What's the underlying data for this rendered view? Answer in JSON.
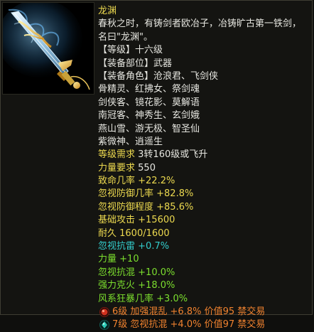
{
  "item": {
    "name": "龙渊",
    "description": [
      "春秋之时，有铸剑者欧冶子，冶铸旷古第一铁剑，",
      "名曰\"龙渊\"。"
    ],
    "level_line": "【等级】十六级",
    "slot_line": "【装备部位】武器",
    "roles_header": "【装备角色】沧浪君、飞剑侠",
    "roles_more": [
      "骨精灵、红拂女、祭剑魂",
      "剑侠客、镜花影、莫解语",
      "南冠客、神秀生、玄剑娥",
      "燕山雪、游无极、智圣仙",
      "紫微神、逍遥生"
    ]
  },
  "stats": {
    "level_req_label": "等级需求",
    "level_req_value": "3转160级或飞升",
    "str_req_label": "力量要求",
    "str_req_value": "550",
    "crit": "致命几率 +22.2%",
    "ignore_def_chance": "忽视防御几率 +82.8%",
    "ignore_def_degree": "忽视防御程度 +85.6%",
    "base_attack": "基础攻击 +15600",
    "durability": "耐久 1600/1600"
  },
  "bonus": {
    "ignore_thunder_label": "忽视抗雷",
    "ignore_thunder_value": "+0.7%",
    "strength_label": "力量",
    "strength_value": "+10",
    "ignore_chaos_label": "忽视抗混",
    "ignore_chaos_value": "+10.0%",
    "fire_label": "强力克火",
    "fire_value": "+18.0%",
    "wind_label": "风系狂暴几率",
    "wind_value": "+3.0%"
  },
  "gems": [
    {
      "icon": "red-gem-icon",
      "text": "6级 加强混乱 +6.8% 价值95 禁交易",
      "color": "#f0822f"
    },
    {
      "icon": "cyan-gem-icon",
      "text": "7级 忽视抗混 +4.0% 价值97 禁交易",
      "color": "#f0822f"
    }
  ],
  "colors": {
    "name": "#ecd94f",
    "desc": "#e6e6e0",
    "requirement_label": "#ecd94f",
    "requirement_value": "#e6e6e0",
    "base_stat": "#ecd94f",
    "bonus_green": "#7cdf2e",
    "bonus_cyan": "#33cccc",
    "gem_text": "#f0822f"
  }
}
